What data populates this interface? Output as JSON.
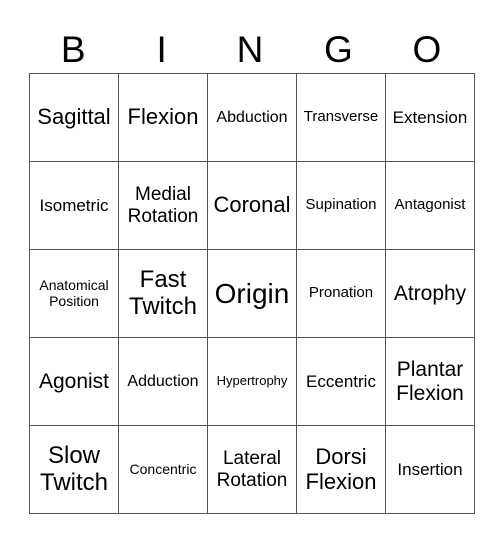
{
  "header": [
    "B",
    "I",
    "N",
    "G",
    "O"
  ],
  "rows": [
    [
      "Sagittal",
      "Flexion",
      "Abduction",
      "Transverse",
      "Extension"
    ],
    [
      "Isometric",
      "Medial Rotation",
      "Coronal",
      "Supination",
      "Antagonist"
    ],
    [
      "Anatomical Position",
      "Fast Twitch",
      "Origin",
      "Pronation",
      "Atrophy"
    ],
    [
      "Agonist",
      "Adduction",
      "Hypertrophy",
      "Eccentric",
      "Plantar Flexion"
    ],
    [
      "Slow Twitch",
      "Concentric",
      "Lateral Rotation",
      "Dorsi Flexion",
      "Insertion"
    ]
  ]
}
